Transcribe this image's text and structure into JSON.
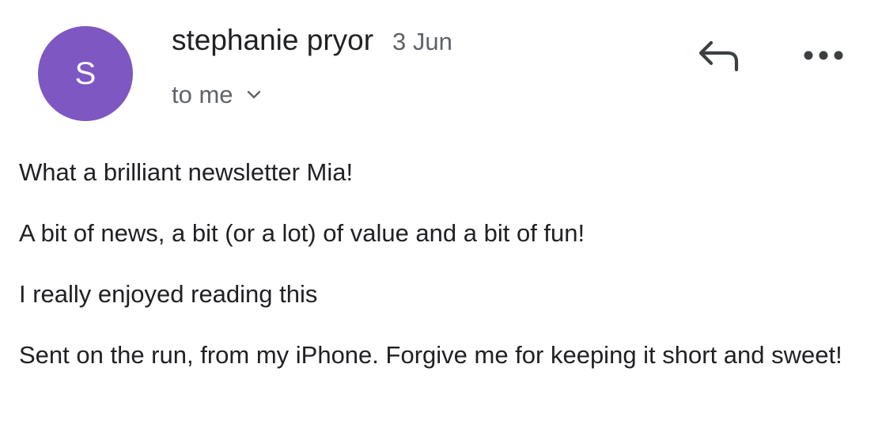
{
  "sender": {
    "initial": "S",
    "name": "stephanie pryor",
    "date": "3 Jun",
    "avatar_color": "#7e57c2"
  },
  "recipient": {
    "label": "to me",
    "expand_icon": "chevron-down-icon"
  },
  "actions": {
    "reply_icon": "reply-icon",
    "more_icon": "more-horizontal-icon"
  },
  "body": {
    "paragraphs": [
      "What a brilliant newsletter Mia!",
      "A bit of news, a bit (or a lot) of value and a bit of fun!",
      "I really enjoyed reading this",
      "Sent on the run, from my iPhone. Forgive me for keeping it short and sweet!"
    ]
  }
}
